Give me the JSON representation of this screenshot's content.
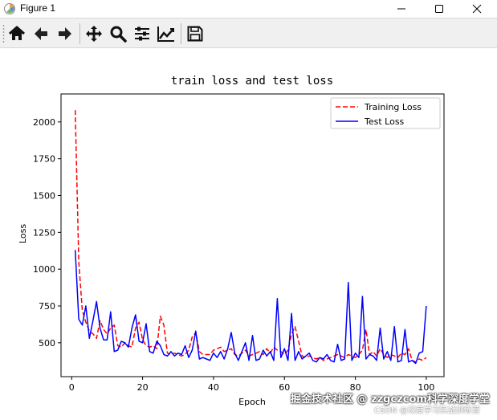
{
  "window": {
    "title": "Figure 1",
    "buttons": [
      "minimize",
      "maximize",
      "close"
    ]
  },
  "toolbar": {
    "tools": [
      {
        "name": "home-icon"
      },
      {
        "name": "back-arrow-icon"
      },
      {
        "name": "forward-arrow-icon"
      },
      {
        "name": "pan-move-icon"
      },
      {
        "name": "zoom-magnifier-icon"
      },
      {
        "name": "configure-subplots-icon"
      },
      {
        "name": "edit-axis-icon"
      },
      {
        "name": "save-icon"
      }
    ]
  },
  "chart_data": {
    "type": "line",
    "title": "train loss and test loss",
    "xlabel": "Epoch",
    "ylabel": "Loss",
    "xlim": [
      -3,
      105
    ],
    "ylim": [
      270,
      2190
    ],
    "xticks": [
      0,
      20,
      40,
      60,
      80,
      100
    ],
    "yticks": [
      500,
      750,
      1000,
      1250,
      1500,
      1750,
      2000
    ],
    "legend": "top-right",
    "series": [
      {
        "name": "Training Loss",
        "color": "#ff0000",
        "style": "dashed",
        "x": [
          1,
          2,
          3,
          4,
          5,
          6,
          7,
          8,
          9,
          10,
          11,
          12,
          13,
          14,
          15,
          16,
          17,
          18,
          19,
          20,
          21,
          22,
          23,
          24,
          25,
          26,
          27,
          28,
          29,
          30,
          31,
          32,
          33,
          34,
          35,
          36,
          37,
          38,
          39,
          40,
          41,
          42,
          43,
          44,
          45,
          46,
          47,
          48,
          49,
          50,
          51,
          52,
          53,
          54,
          55,
          56,
          57,
          58,
          59,
          60,
          61,
          62,
          63,
          64,
          65,
          66,
          67,
          68,
          69,
          70,
          71,
          72,
          73,
          74,
          75,
          76,
          77,
          78,
          79,
          80,
          81,
          82,
          83,
          84,
          85,
          86,
          87,
          88,
          89,
          90,
          91,
          92,
          93,
          94,
          95,
          96,
          97,
          98,
          99,
          100
        ],
        "y": [
          2080,
          1050,
          720,
          640,
          580,
          560,
          530,
          650,
          590,
          560,
          600,
          620,
          480,
          470,
          500,
          480,
          470,
          600,
          640,
          520,
          480,
          470,
          480,
          460,
          680,
          620,
          430,
          420,
          430,
          420,
          410,
          420,
          450,
          540,
          570,
          440,
          420,
          420,
          420,
          450,
          460,
          470,
          440,
          450,
          460,
          420,
          410,
          430,
          450,
          410,
          420,
          430,
          440,
          420,
          460,
          430,
          470,
          450,
          440,
          420,
          450,
          560,
          610,
          510,
          410,
          400,
          410,
          400,
          390,
          400,
          380,
          390,
          400,
          410,
          420,
          410,
          400,
          420,
          410,
          400,
          420,
          450,
          590,
          420,
          440,
          410,
          460,
          420,
          400,
          420,
          410,
          400,
          430,
          420,
          460,
          380,
          370,
          390,
          380,
          400
        ]
      },
      {
        "name": "Test Loss",
        "color": "#0000ff",
        "style": "solid",
        "x": [
          1,
          2,
          3,
          4,
          5,
          6,
          7,
          8,
          9,
          10,
          11,
          12,
          13,
          14,
          15,
          16,
          17,
          18,
          19,
          20,
          21,
          22,
          23,
          24,
          25,
          26,
          27,
          28,
          29,
          30,
          31,
          32,
          33,
          34,
          35,
          36,
          37,
          38,
          39,
          40,
          41,
          42,
          43,
          44,
          45,
          46,
          47,
          48,
          49,
          50,
          51,
          52,
          53,
          54,
          55,
          56,
          57,
          58,
          59,
          60,
          61,
          62,
          63,
          64,
          65,
          66,
          67,
          68,
          69,
          70,
          71,
          72,
          73,
          74,
          75,
          76,
          77,
          78,
          79,
          80,
          81,
          82,
          83,
          84,
          85,
          86,
          87,
          88,
          89,
          90,
          91,
          92,
          93,
          94,
          95,
          96,
          97,
          98,
          99,
          100
        ],
        "y": [
          1130,
          660,
          620,
          750,
          530,
          650,
          780,
          600,
          520,
          520,
          710,
          440,
          450,
          510,
          500,
          470,
          600,
          690,
          510,
          500,
          630,
          440,
          430,
          510,
          480,
          420,
          410,
          440,
          410,
          430,
          420,
          480,
          400,
          450,
          580,
          390,
          400,
          390,
          380,
          430,
          400,
          440,
          390,
          460,
          570,
          430,
          380,
          440,
          500,
          380,
          550,
          380,
          390,
          450,
          410,
          440,
          380,
          800,
          400,
          460,
          380,
          700,
          380,
          440,
          390,
          410,
          430,
          380,
          370,
          400,
          390,
          420,
          380,
          370,
          490,
          380,
          390,
          910,
          380,
          430,
          400,
          815,
          390,
          420,
          410,
          380,
          600,
          390,
          440,
          380,
          610,
          370,
          380,
          590,
          370,
          380,
          360,
          430,
          440,
          750
        ]
      }
    ]
  },
  "watermark": {
    "line1": "掘金技术社区 @ zzgczcom科学深度学堂",
    "line2": "CSDN @深度学习实战训练营"
  }
}
